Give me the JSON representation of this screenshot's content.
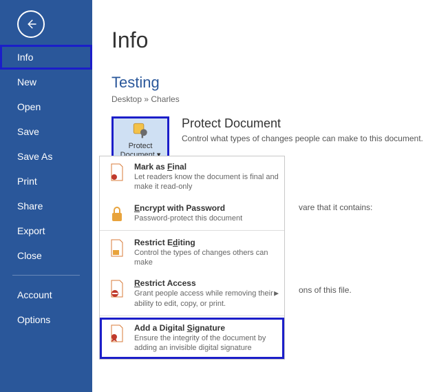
{
  "sidebar": {
    "items": [
      {
        "label": "Info"
      },
      {
        "label": "New"
      },
      {
        "label": "Open"
      },
      {
        "label": "Save"
      },
      {
        "label": "Save As"
      },
      {
        "label": "Print"
      },
      {
        "label": "Share"
      },
      {
        "label": "Export"
      },
      {
        "label": "Close"
      }
    ],
    "bottom": [
      {
        "label": "Account"
      },
      {
        "label": "Options"
      }
    ]
  },
  "content": {
    "title": "Info",
    "docName": "Testing",
    "breadcrumb": "Desktop » Charles",
    "protectBtnLine1": "Protect",
    "protectBtnLine2": "Document",
    "protectTitle": "Protect Document",
    "protectSub": "Control what types of changes people can make to this document.",
    "bgText1": "vare that it contains:",
    "bgText2": "ons of this file."
  },
  "dropdown": {
    "items": [
      {
        "title": "Mark as Final",
        "desc": "Let readers know the document is final and make it read-only",
        "mn": "F"
      },
      {
        "title": "Encrypt with Password",
        "desc": "Password-protect this document",
        "mn": "E"
      },
      {
        "title": "Restrict Editing",
        "desc": "Control the types of changes others can make",
        "mn": "D"
      },
      {
        "title": "Restrict Access",
        "desc": "Grant people access while removing their ability to edit, copy, or print.",
        "mn": "R",
        "arrow": true
      },
      {
        "title": "Add a Digital Signature",
        "desc": "Ensure the integrity of the document by adding an invisible digital signature",
        "mn": "S"
      }
    ]
  },
  "colors": {
    "blueAccent": "#2a579a",
    "highlightBorder": "#1b1ec9"
  }
}
